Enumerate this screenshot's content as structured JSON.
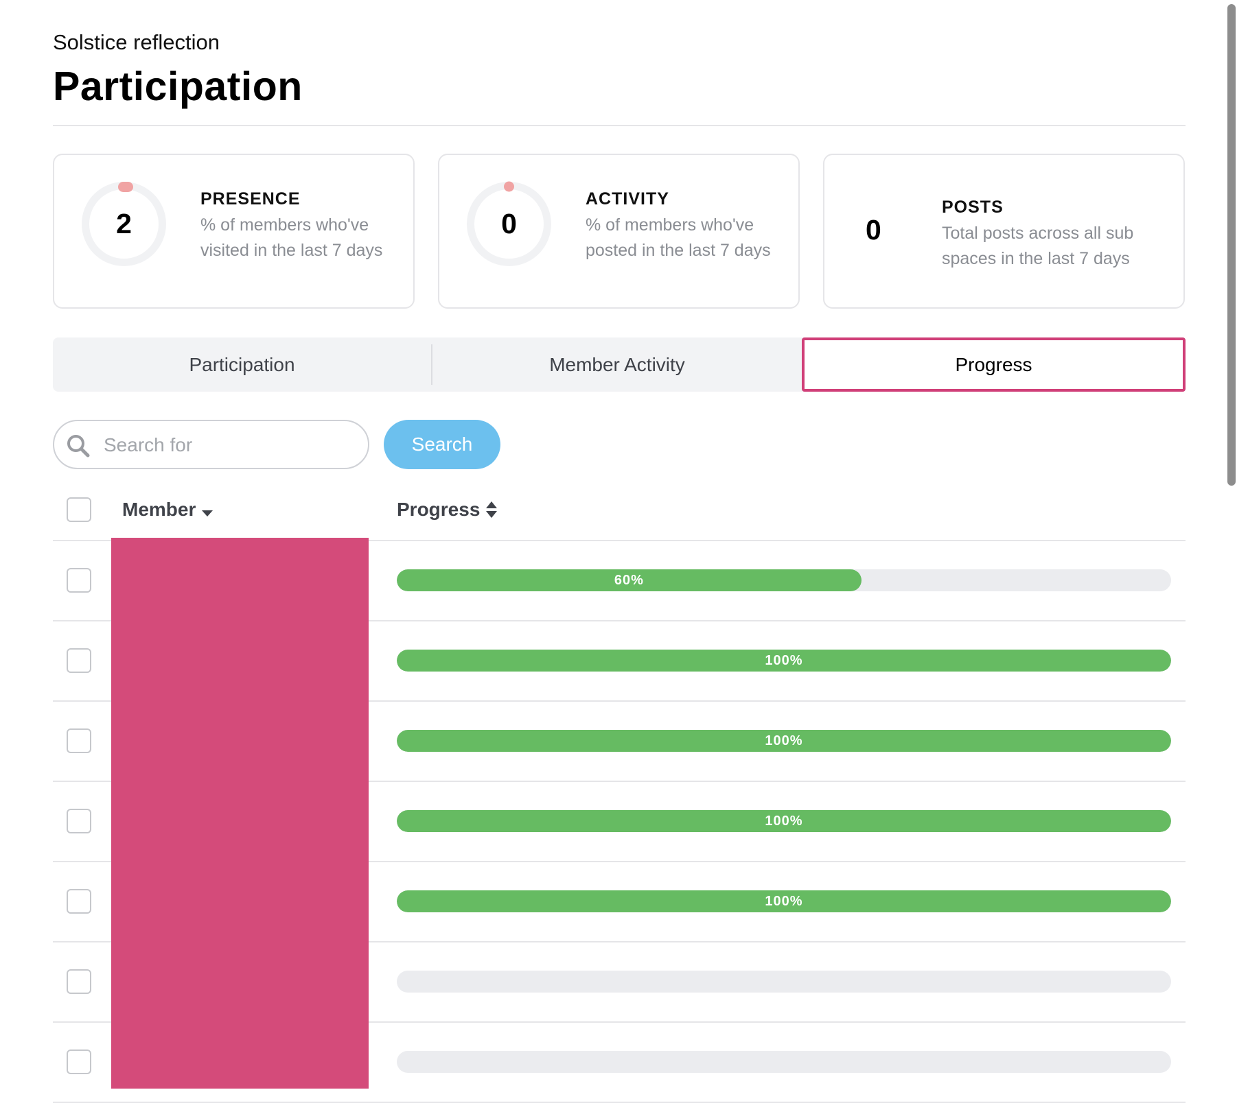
{
  "header": {
    "subtitle": "Solstice reflection",
    "title": "Participation"
  },
  "stats": [
    {
      "label": "PRESENCE",
      "value": "2",
      "description": "% of members who've visited in the last 7 days",
      "percent": 2
    },
    {
      "label": "ACTIVITY",
      "value": "0",
      "description": "% of members who've posted in the last 7 days",
      "percent": 0
    },
    {
      "label": "POSTS",
      "value": "0",
      "description": "Total posts across all sub spaces in the last 7 days"
    }
  ],
  "colors": {
    "ring_track": "#f1f2f4",
    "ring_marker": "#f0a3a3",
    "accent_tab_border": "#d03f78",
    "progress_fill": "#66bb62",
    "progress_track": "#ebecef",
    "search_button": "#6cc0ee",
    "redaction": "#d44b7a"
  },
  "tabs": [
    {
      "label": "Participation",
      "active": false
    },
    {
      "label": "Member Activity",
      "active": false
    },
    {
      "label": "Progress",
      "active": true
    }
  ],
  "search": {
    "placeholder": "Search for",
    "button_label": "Search",
    "icon": "search-icon"
  },
  "table": {
    "columns": [
      {
        "label": "Member",
        "sort_icon": "caret-down-icon"
      },
      {
        "label": "Progress",
        "sort_icon": "sort-icon"
      }
    ],
    "rows": [
      {
        "progress": 60,
        "label": "60%"
      },
      {
        "progress": 100,
        "label": "100%"
      },
      {
        "progress": 100,
        "label": "100%"
      },
      {
        "progress": 100,
        "label": "100%"
      },
      {
        "progress": 100,
        "label": "100%"
      },
      {
        "progress": 0,
        "label": ""
      },
      {
        "progress": 0,
        "label": ""
      }
    ]
  }
}
